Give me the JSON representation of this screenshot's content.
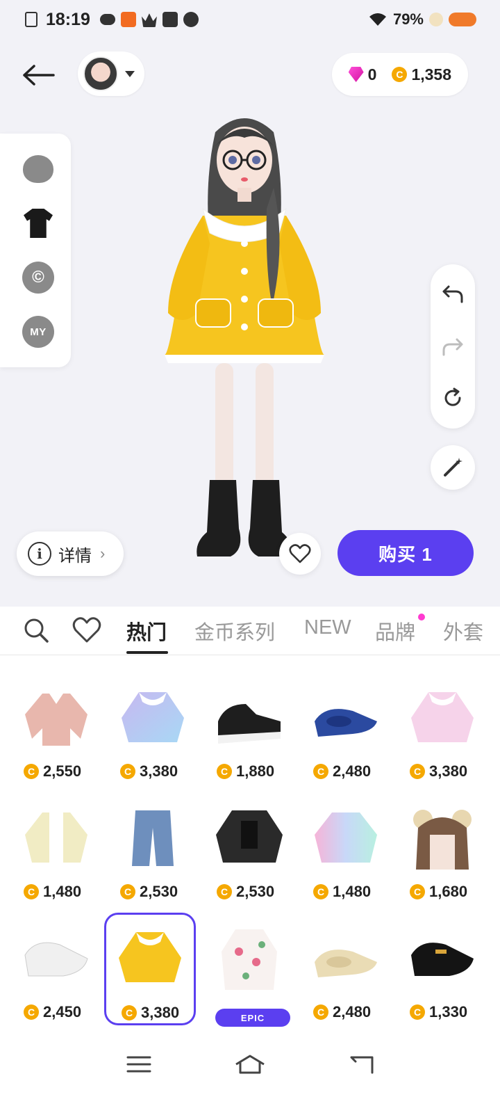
{
  "status_bar": {
    "time": "18:19",
    "battery": "79%"
  },
  "header": {
    "gems": "0",
    "coins": "1,358"
  },
  "side_panel": {
    "items": [
      {
        "name": "head-icon"
      },
      {
        "name": "tshirt-icon"
      },
      {
        "name": "copyright-icon",
        "glyph": "©"
      },
      {
        "name": "my-icon",
        "label": "MY"
      }
    ]
  },
  "actions": {
    "detail_label": "详情",
    "buy_label": "购买 1"
  },
  "tabs": [
    {
      "label": "热门",
      "active": true
    },
    {
      "label": "金币系列",
      "active": false
    },
    {
      "label": "NEW",
      "active": false
    },
    {
      "label": "品牌",
      "active": false
    },
    {
      "label": "外套",
      "active": false
    }
  ],
  "items": [
    {
      "price": "2,550",
      "kind": "pink-cardigan"
    },
    {
      "price": "3,380",
      "kind": "pastel-dress"
    },
    {
      "price": "1,880",
      "kind": "black-sneakers"
    },
    {
      "price": "2,480",
      "kind": "blue-flats"
    },
    {
      "price": "3,380",
      "kind": "pink-dress"
    },
    {
      "price": "1,480",
      "kind": "cream-cardigan"
    },
    {
      "price": "2,530",
      "kind": "denim-jeans"
    },
    {
      "price": "2,530",
      "kind": "black-jacket"
    },
    {
      "price": "1,480",
      "kind": "rainbow-sweater"
    },
    {
      "price": "1,680",
      "kind": "bear-hair"
    },
    {
      "price": "2,450",
      "kind": "white-loafers"
    },
    {
      "price": "3,380",
      "kind": "yellow-dress",
      "selected": true
    },
    {
      "badge": "EPIC",
      "kind": "floral-dress"
    },
    {
      "price": "2,480",
      "kind": "beige-flats"
    },
    {
      "price": "1,330",
      "kind": "black-loafers"
    }
  ],
  "colors": {
    "accent": "#5b3ff0",
    "coin": "#f5a800",
    "gem": "#ff4fd8"
  }
}
